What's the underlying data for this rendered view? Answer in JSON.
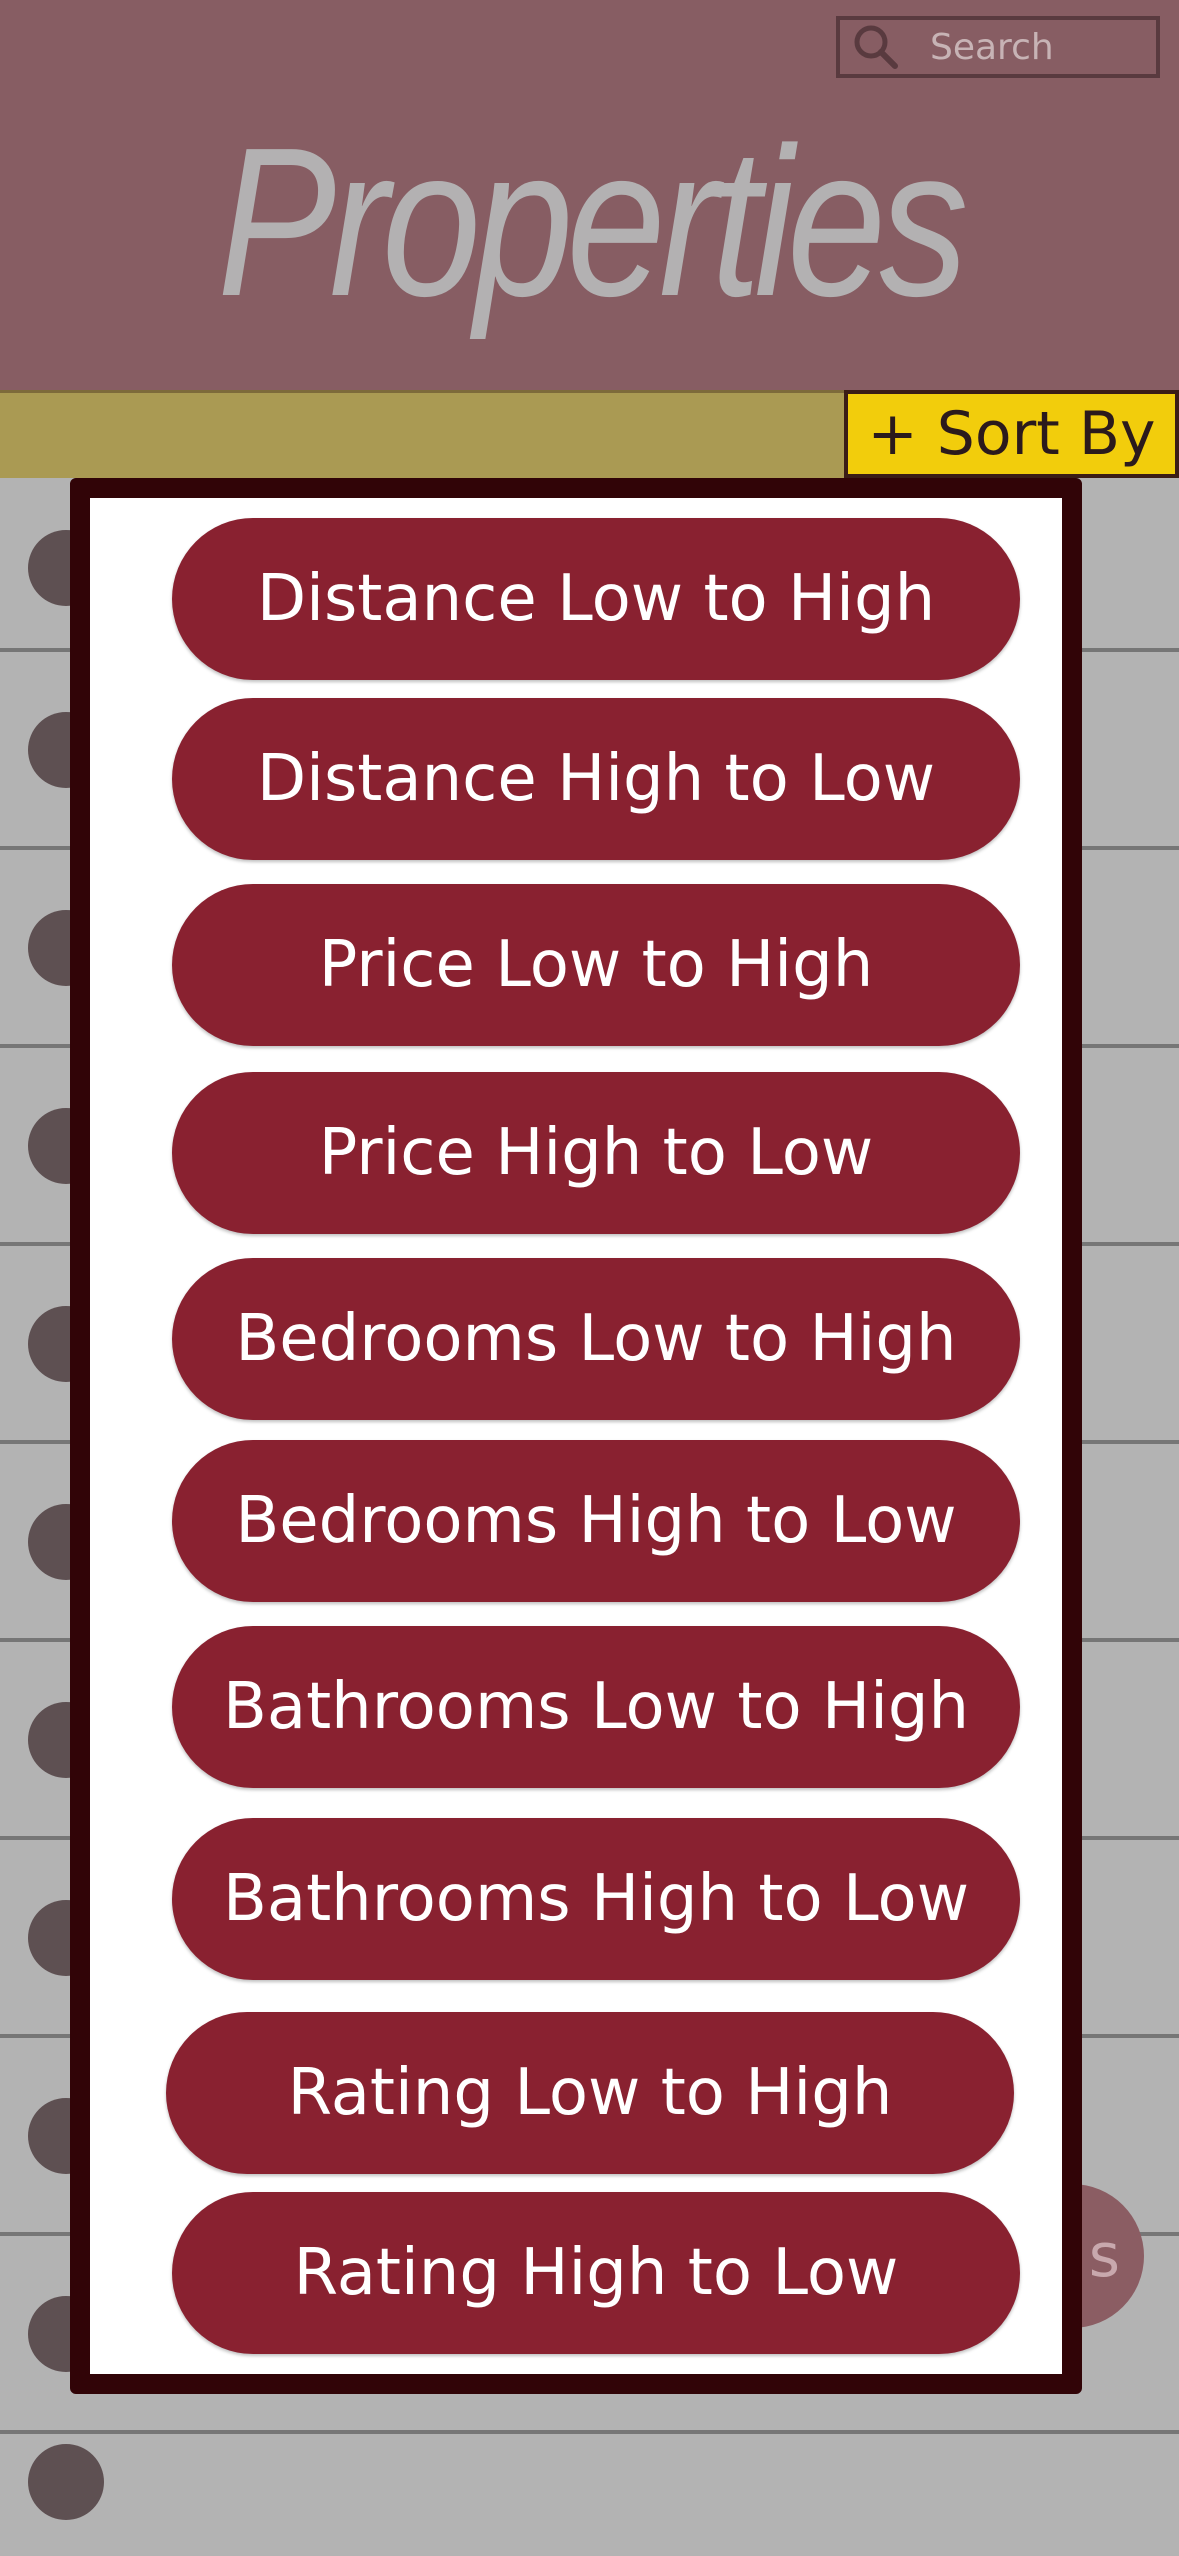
{
  "header": {
    "title": "Properties",
    "search_placeholder": "Search"
  },
  "sort_button": {
    "label": "+ Sort By"
  },
  "sort_options": [
    "Distance Low to High",
    "Distance High to Low",
    "Price Low to High",
    "Price High to Low",
    "Bedrooms Low to High",
    "Bedrooms High to Low",
    "Bathrooms Low to High",
    "Bathrooms High to Low",
    "Rating Low to High",
    "Rating High to Low"
  ],
  "fab": {
    "label": "s"
  },
  "colors": {
    "header_bg": "#875d63",
    "accent_bar": "#aa9a53",
    "sort_button_bg": "#f2cd0c",
    "option_bg": "#892130",
    "modal_border": "#310407"
  },
  "icons": {
    "search": "search-icon"
  }
}
